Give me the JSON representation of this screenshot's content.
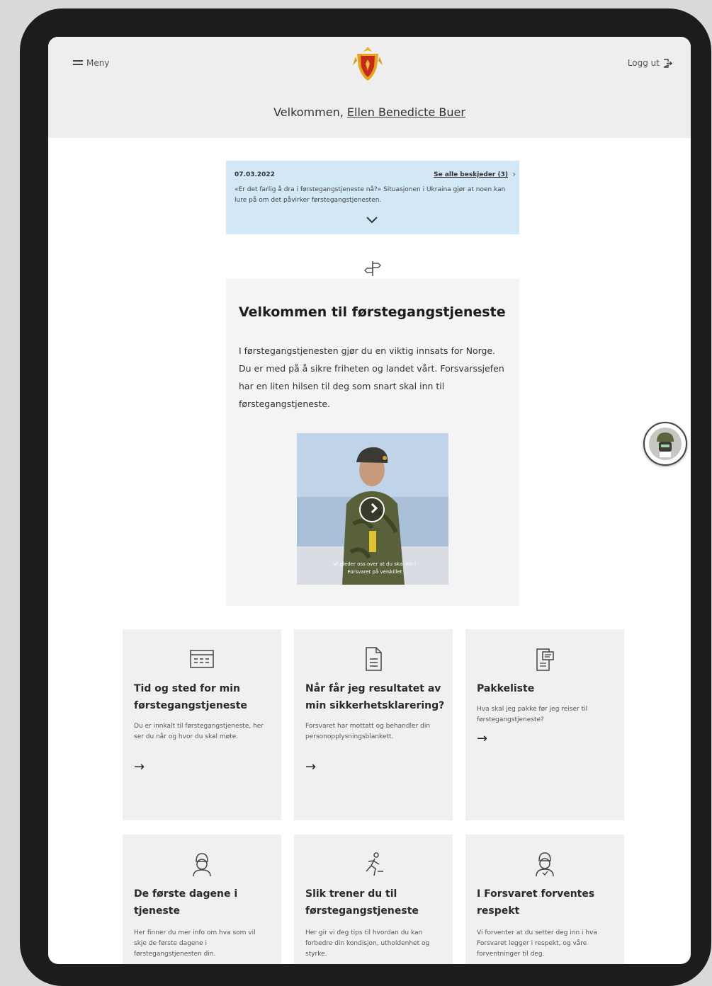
{
  "header": {
    "menu_label": "Meny",
    "logout_label": "Logg ut",
    "welcome_prefix": "Velkommen,",
    "user_name": "Ellen Benedicte Buer"
  },
  "notice": {
    "date": "07.03.2022",
    "see_all_link": "Se alle beskjeder (3)",
    "text": "«Er det farlig å dra i førstegangstjeneste nå?» Situasjonen i Ukraina gjør at noen kan lure på om det påvirker førstegangstjenesten."
  },
  "intro": {
    "title": "Velkommen til førstegangstjeneste",
    "body": "I førstegangstjenesten gjør du en viktig innsats for Norge. Du er med på å sikre friheten og landet vårt. Forsvarssjefen har en liten hilsen til deg som snart skal inn til førstegangstjeneste.",
    "video_caption": "Vi gleder oss over at du skal inn i Forsvaret på veiskillet"
  },
  "cards": [
    {
      "title": "Tid og sted for min førstegangstjeneste",
      "desc": "Du er innkalt til førstegangstjeneste, her ser du når og hvor du skal møte.",
      "icon": "calendar-icon"
    },
    {
      "title": "Når får jeg resultatet av min sikkerhetsklarering?",
      "desc": "Forsvaret har mottatt og behandler din personopplysningsblankett.",
      "icon": "document-icon"
    },
    {
      "title": "Pakkeliste",
      "desc": "Hva skal jeg pakke før jeg reiser til førstegangstjeneste?",
      "icon": "packing-list-icon"
    },
    {
      "title": "De første dagene i tjeneste",
      "desc": "Her finner du mer info om hva som vil skje de første dagene i førstegangstjenesten din.",
      "icon": "soldier-icon"
    },
    {
      "title": "Slik trener du til førstegangstjeneste",
      "desc": "Her gir vi deg tips til hvordan du kan forbedre din kondisjon, utholdenhet og styrke.",
      "icon": "running-icon"
    },
    {
      "title": "I Forsvaret forventes respekt",
      "desc": "Vi forventer at du setter deg inn i hva Forsvaret legger i respekt, og våre forventninger til deg.",
      "icon": "respect-icon"
    }
  ]
}
